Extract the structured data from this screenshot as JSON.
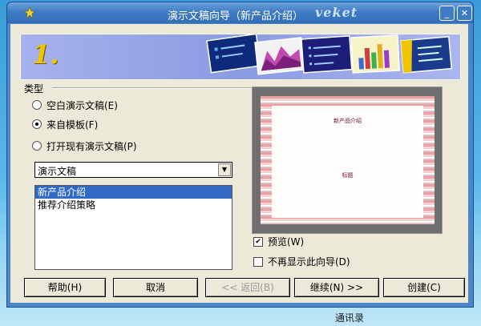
{
  "window": {
    "title": "演示文稿向导（新产品介绍）",
    "brand": "veket",
    "controls": {
      "minimize": "_",
      "close": "✕"
    }
  },
  "banner": {
    "step": "1."
  },
  "type_group": {
    "label": "类型",
    "options": [
      {
        "label": "空白演示文稿(E)",
        "selected": false
      },
      {
        "label": "来自模板(F)",
        "selected": true
      },
      {
        "label": "打开现有演示文稿(P)",
        "selected": false
      }
    ]
  },
  "template_category": {
    "value": "演示文稿"
  },
  "template_list": {
    "items": [
      "新产品介绍",
      "推荐介绍策略"
    ],
    "selected_index": 0
  },
  "preview": {
    "slide_title": "新产品介绍",
    "slide_subtitle": "标题",
    "show_preview": {
      "label": "预览(W)",
      "checked": true
    },
    "dont_show_again": {
      "label": "不再显示此向导(D)",
      "checked": false
    }
  },
  "buttons": {
    "help": "帮助(H)",
    "cancel": "取消",
    "back": "<< 返回(B)",
    "next": "继续(N) >>",
    "create": "创建(C)"
  },
  "desktop": {
    "label": "通讯录"
  },
  "colors": {
    "title_bar": "#3f7cc4",
    "client_bg": "#ece9d8",
    "selection": "#316ac5"
  }
}
